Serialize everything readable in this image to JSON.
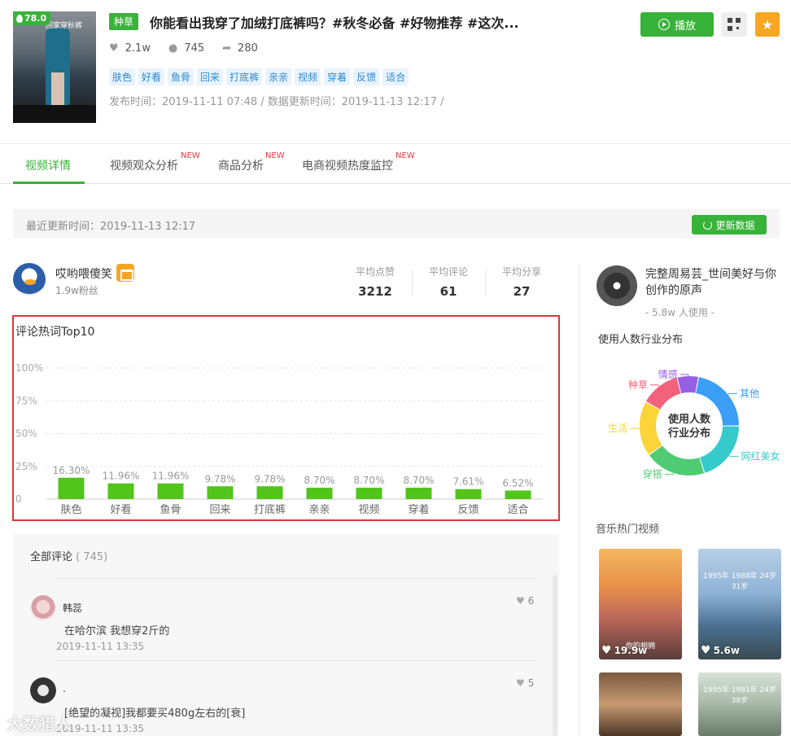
{
  "video": {
    "score": "78.0",
    "thumb_overlay_text": "回家穿秋裤",
    "category_tag": "种草",
    "title": "你能看出我穿了加绒打底裤吗？#秋冬必备 #好物推荐 #这次...",
    "likes": "2.1w",
    "comments": "745",
    "shares": "280",
    "keywords": [
      "肤色",
      "好看",
      "鱼骨",
      "回来",
      "打底裤",
      "亲亲",
      "视频",
      "穿着",
      "反馈",
      "适合"
    ],
    "publish_info": "发布时间：2019-11-11 07:48 / 数据更新时间：2019-11-13 12:17 /",
    "play_label": "播放"
  },
  "tabs": [
    {
      "label": "视频详情",
      "new": ""
    },
    {
      "label": "视频观众分析",
      "new": "NEW"
    },
    {
      "label": "商品分析",
      "new": "NEW"
    },
    {
      "label": "电商视频热度监控",
      "new": "NEW"
    }
  ],
  "update": {
    "text": "最近更新时间：2019-11-13 12:17",
    "refresh_label": "更新数据"
  },
  "author": {
    "name": "哎哟喂傻笑",
    "fans": "1.9w粉丝",
    "stats": [
      {
        "label": "平均点赞",
        "value": "3212"
      },
      {
        "label": "平均评论",
        "value": "61"
      },
      {
        "label": "平均分享",
        "value": "27"
      }
    ]
  },
  "chart_data": {
    "type": "bar",
    "title": "评论热词Top10",
    "categories": [
      "肤色",
      "好看",
      "鱼骨",
      "回来",
      "打底裤",
      "亲亲",
      "视频",
      "穿着",
      "反馈",
      "适合"
    ],
    "values": [
      16.3,
      11.96,
      11.96,
      9.78,
      9.78,
      8.7,
      8.7,
      8.7,
      7.61,
      6.52
    ],
    "value_labels": [
      "16.30%",
      "11.96%",
      "11.96%",
      "9.78%",
      "9.78%",
      "8.70%",
      "8.70%",
      "8.70%",
      "7.61%",
      "6.52%"
    ],
    "yticks": [
      "0",
      "25%",
      "50%",
      "75%",
      "100%"
    ],
    "ylim": [
      0,
      100
    ],
    "color": "#52c41a",
    "grid": true
  },
  "comments": {
    "title": "全部评论",
    "count": "( 745)",
    "items": [
      {
        "name": "韩蕊",
        "text": "在哈尔滨 我想穿2斤的",
        "time": "2019-11-11 13:35",
        "likes": "6"
      },
      {
        "name": ".",
        "text": "[绝望的凝视]我都要买480g左右的[衰]",
        "time": "2019-11-11 13:35",
        "likes": "5"
      }
    ]
  },
  "music": {
    "title": "完整周易芸_世间美好与你　　创作的原声",
    "users": "- 5.8w 人使用 -",
    "dist_title": "使用人数行业分布",
    "donut_center": [
      "使用人数",
      "行业分布"
    ],
    "segments": [
      {
        "label": "其他",
        "value": 22,
        "color": "#3a9ff5"
      },
      {
        "label": "网红美女",
        "value": 20,
        "color": "#36cbcb"
      },
      {
        "label": "穿搭",
        "value": 20,
        "color": "#4ecb73"
      },
      {
        "label": "生活",
        "value": 18,
        "color": "#fbd437"
      },
      {
        "label": "种草",
        "value": 13,
        "color": "#f2637b"
      },
      {
        "label": "情感",
        "value": 7,
        "color": "#975fe5"
      }
    ],
    "hot_title": "音乐热门视频",
    "videos": [
      {
        "likes": "19.9w",
        "caption": "你的相拥"
      },
      {
        "likes": "5.6w",
        "caption": "1995年 1988年 24岁 31岁"
      },
      {
        "likes": "",
        "caption": ""
      },
      {
        "likes": "",
        "caption": "1995年 1981年 24岁 38岁"
      }
    ]
  },
  "watermark": "大数猎人"
}
